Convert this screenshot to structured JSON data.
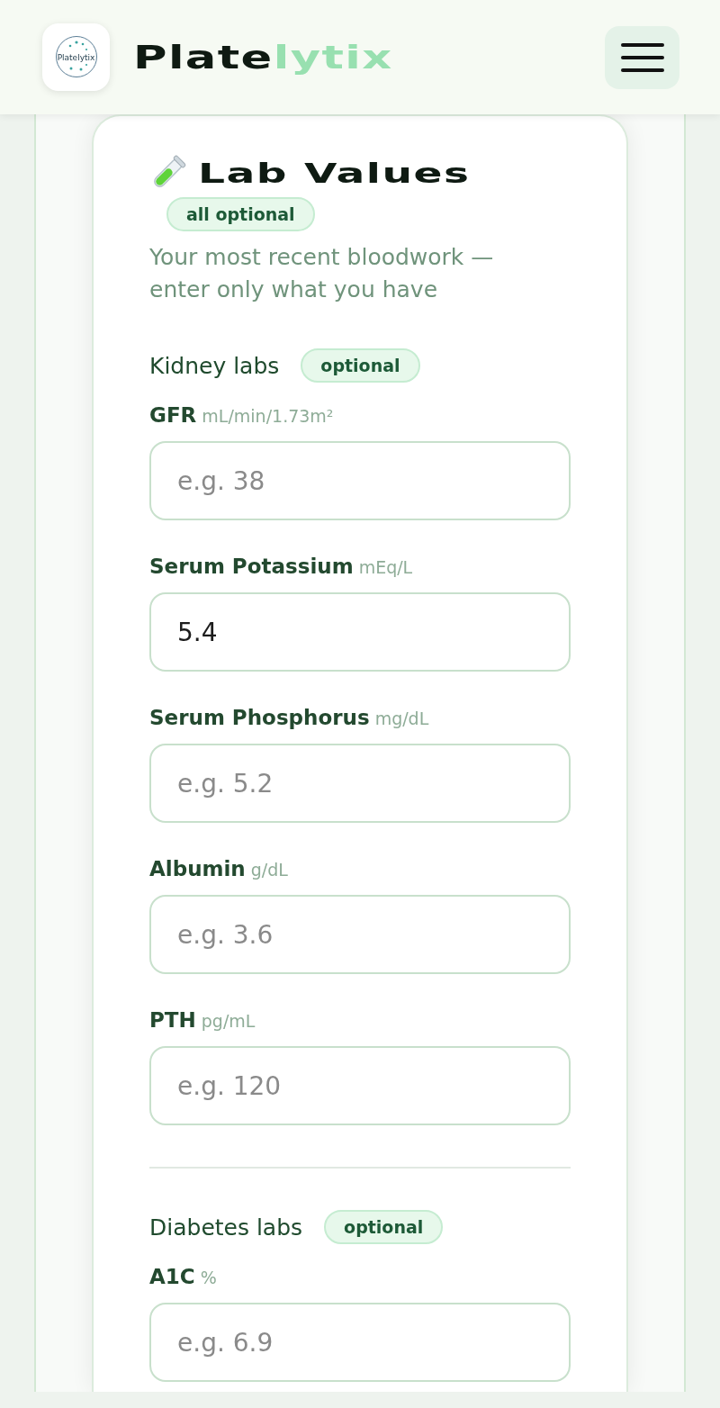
{
  "header": {
    "logo": {
      "text": "Platelytix"
    },
    "brand": {
      "parts": [
        {
          "text": "Plate",
          "kind": "dark"
        },
        {
          "text": "lytix",
          "kind": "accent"
        }
      ]
    }
  },
  "lab_values": {
    "title": "Lab Values",
    "badge": "all optional",
    "subtitle": "Your most recent bloodwork — enter only what you have",
    "groups": [
      {
        "title": "Kidney labs",
        "badge": "optional",
        "fields": [
          {
            "label": "GFR",
            "unit": "mL/min/1.73m²",
            "placeholder": "e.g. 38"
          },
          {
            "label": "Serum Potassium",
            "unit": "mEq/L",
            "value": "5.4"
          },
          {
            "label": "Serum Phosphorus",
            "unit": "mg/dL",
            "placeholder": "e.g. 5.2"
          },
          {
            "label": "Albumin",
            "unit": "g/dL",
            "placeholder": "e.g. 3.6"
          },
          {
            "label": "PTH",
            "unit": "pg/mL",
            "placeholder": "e.g. 120"
          }
        ]
      },
      {
        "title": "Diabetes labs",
        "badge": "optional",
        "fields": [
          {
            "label": "A1C",
            "unit": "%",
            "placeholder": "e.g. 6.9"
          }
        ]
      }
    ]
  }
}
